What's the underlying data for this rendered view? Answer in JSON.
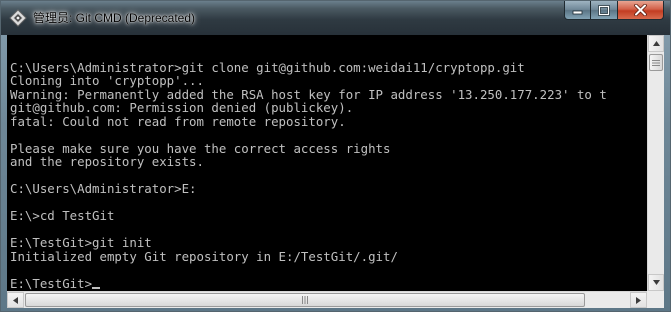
{
  "window": {
    "title": "管理员: Git CMD (Deprecated)"
  },
  "icons": {
    "app": "git-cmd-diamond-icon",
    "minimize": "minimize-icon",
    "maximize": "maximize-icon",
    "close": "close-icon",
    "scroll_up": "arrow-up-icon",
    "scroll_down": "arrow-down-icon",
    "scroll_left": "arrow-left-icon",
    "scroll_right": "arrow-right-icon"
  },
  "terminal": {
    "lines": [
      "",
      "C:\\Users\\Administrator>git clone git@github.com:weidai11/cryptopp.git",
      "Cloning into 'cryptopp'...",
      "Warning: Permanently added the RSA host key for IP address '13.250.177.223' to t",
      "git@github.com: Permission denied (publickey).",
      "fatal: Could not read from remote repository.",
      "",
      "Please make sure you have the correct access rights",
      "and the repository exists.",
      "",
      "C:\\Users\\Administrator>E:",
      "",
      "E:\\>cd TestGit",
      "",
      "E:\\TestGit>git init",
      "Initialized empty Git repository in E:/TestGit/.git/",
      ""
    ],
    "prompt": "E:\\TestGit>"
  },
  "colors": {
    "terminal_background": "#000000",
    "terminal_text": "#c0c0c0",
    "close_button": "#c23d22"
  }
}
